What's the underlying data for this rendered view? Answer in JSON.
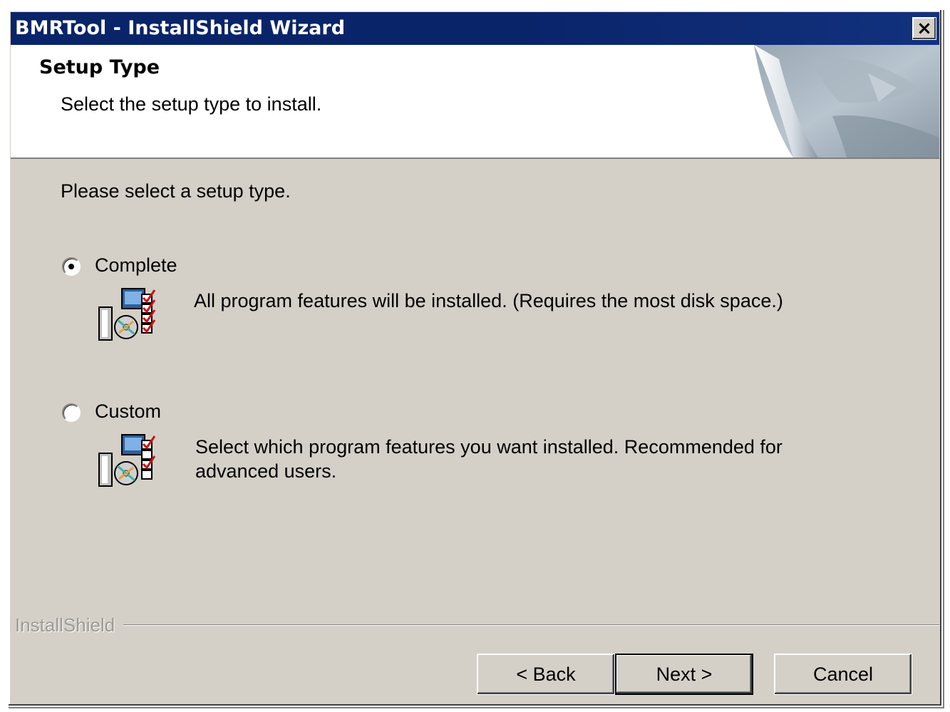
{
  "window": {
    "title": "BMRTool - InstallShield Wizard",
    "close_label": "×"
  },
  "header": {
    "title": "Setup Type",
    "subtitle": "Select the setup type to install."
  },
  "body": {
    "prompt": "Please select a setup type.",
    "options": [
      {
        "label": "Complete",
        "description": "All program features will be installed. (Requires the most disk space.)",
        "selected": true,
        "icon": "setup-complete-icon"
      },
      {
        "label": "Custom",
        "description": "Select which program features you want installed. Recommended for advanced users.",
        "selected": false,
        "icon": "setup-custom-icon"
      }
    ]
  },
  "footer": {
    "brand": "InstallShield",
    "back_label": "< Back",
    "next_label": "Next >",
    "cancel_label": "Cancel"
  },
  "colors": {
    "titlebar": "#0a246a",
    "dialog_face": "#d4d0c8",
    "header_bg": "#ffffff"
  }
}
